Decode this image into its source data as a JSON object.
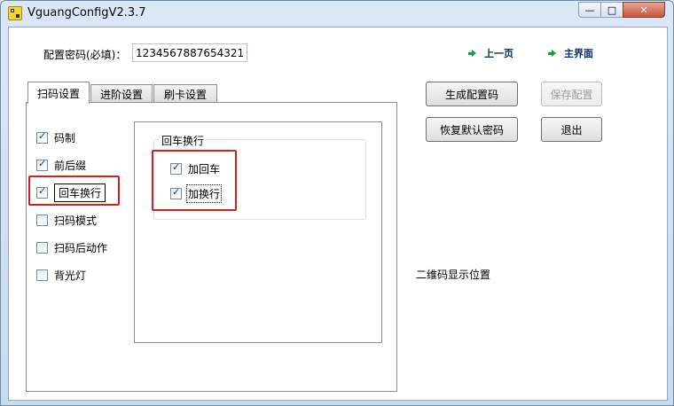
{
  "window": {
    "title": "VguangConfigV2.3.7",
    "controls": {
      "minimize": "—",
      "maximize": "□",
      "close": "✕"
    }
  },
  "password": {
    "label": "配置密码(必填)：",
    "value": "1234567887654321"
  },
  "nav": {
    "prev": "上一页",
    "home": "主界面"
  },
  "tabs": [
    {
      "label": "扫码设置",
      "active": true
    },
    {
      "label": "进阶设置",
      "active": false
    },
    {
      "label": "刷卡设置",
      "active": false
    }
  ],
  "options": [
    {
      "label": "码制",
      "checked": true
    },
    {
      "label": "前后缀",
      "checked": true
    },
    {
      "label": "回车换行",
      "checked": true,
      "selected": true
    },
    {
      "label": "扫码模式",
      "checked": false
    },
    {
      "label": "扫码后动作",
      "checked": false
    },
    {
      "label": "背光灯",
      "checked": false
    }
  ],
  "group": {
    "title": "回车换行",
    "items": [
      {
        "label": "加回车",
        "checked": true
      },
      {
        "label": "加换行",
        "checked": true
      }
    ]
  },
  "buttons": {
    "generate": "生成配置码",
    "save": "保存配置",
    "restore": "恢复默认密码",
    "exit": "退出"
  },
  "qr_position_label": "二维码显示位置",
  "colors": {
    "highlight": "#d32020",
    "nav_arrow": "#1e9a3c",
    "nav_text": "#0b2a6b"
  }
}
